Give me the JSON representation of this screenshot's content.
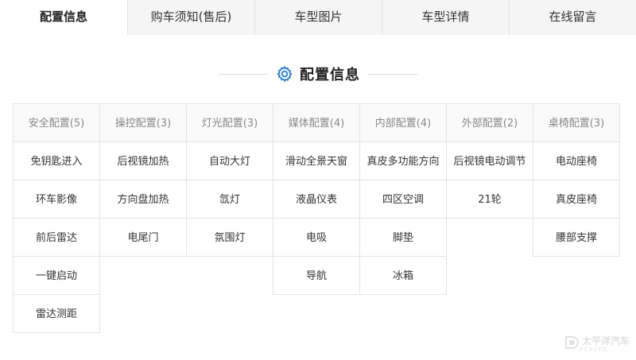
{
  "tabs": [
    {
      "label": "配置信息",
      "active": true
    },
    {
      "label": "购车须知(售后)",
      "active": false
    },
    {
      "label": "车型图片",
      "active": false
    },
    {
      "label": "车型详情",
      "active": false
    },
    {
      "label": "在线留言",
      "active": false
    }
  ],
  "section": {
    "title": "配置信息",
    "icon": "gear-icon",
    "accent": "#2b7fd6"
  },
  "columns": [
    {
      "header": "安全配置(5)",
      "items": [
        "免钥匙进入",
        "环车影像",
        "前后雷达",
        "一键启动",
        "雷达测距"
      ]
    },
    {
      "header": "操控配置(3)",
      "items": [
        "后视镜加热",
        "方向盘加热",
        "电尾门"
      ]
    },
    {
      "header": "灯光配置(3)",
      "items": [
        "自动大灯",
        "氙灯",
        "氛围灯"
      ]
    },
    {
      "header": "媒体配置(4)",
      "items": [
        "滑动全景天窗",
        "液晶仪表",
        "电吸",
        "导航"
      ]
    },
    {
      "header": "内部配置(4)",
      "items": [
        "真皮多功能方向",
        "四区空调",
        "脚垫",
        "冰箱"
      ]
    },
    {
      "header": "外部配置(2)",
      "items": [
        "后视镜电动调节",
        "21轮"
      ]
    },
    {
      "header": "桌椅配置(3)",
      "items": [
        "电动座椅",
        "真皮座椅",
        "腰部支撑"
      ]
    }
  ],
  "watermark": {
    "text": "太平洋汽车",
    "sub": "PCAUTO"
  }
}
